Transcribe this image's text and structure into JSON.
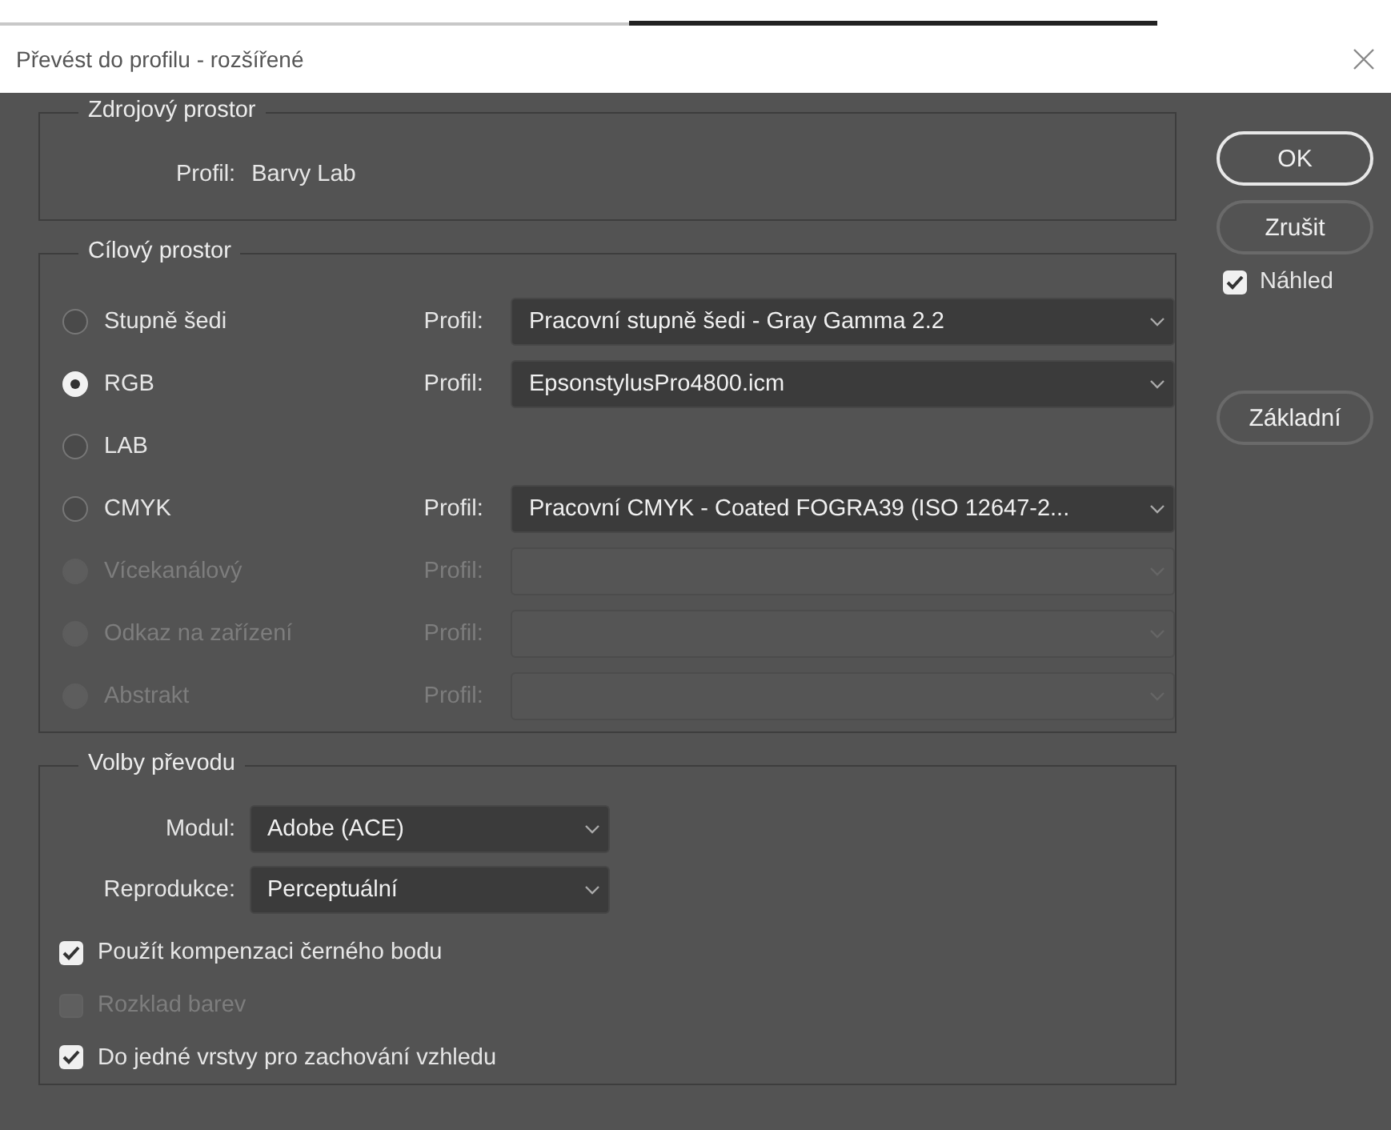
{
  "window": {
    "title": "Převést do profilu - rozšířené"
  },
  "source_space": {
    "title": "Zdrojový prostor",
    "profile_label": "Profil:",
    "profile_value": "Barvy Lab"
  },
  "target_space": {
    "title": "Cílový prostor",
    "rows": [
      {
        "label": "Stupně šedi",
        "selected": false,
        "disabled": false,
        "profile_label": "Profil:",
        "profile_value": "Pracovní stupně šedi - Gray Gamma 2.2"
      },
      {
        "label": "RGB",
        "selected": true,
        "disabled": false,
        "profile_label": "Profil:",
        "profile_value": "EpsonstylusPro4800.icm"
      },
      {
        "label": "LAB",
        "selected": false,
        "disabled": false
      },
      {
        "label": "CMYK",
        "selected": false,
        "disabled": false,
        "profile_label": "Profil:",
        "profile_value": "Pracovní CMYK - Coated FOGRA39 (ISO 12647-2..."
      },
      {
        "label": "Vícekanálový",
        "selected": false,
        "disabled": true,
        "profile_label": "Profil:",
        "profile_value": ""
      },
      {
        "label": "Odkaz na zařízení",
        "selected": false,
        "disabled": true,
        "profile_label": "Profil:",
        "profile_value": ""
      },
      {
        "label": "Abstrakt",
        "selected": false,
        "disabled": true,
        "profile_label": "Profil:",
        "profile_value": ""
      }
    ]
  },
  "conversion_options": {
    "title": "Volby převodu",
    "fields": [
      {
        "label": "Modul:",
        "value": "Adobe (ACE)"
      },
      {
        "label": "Reprodukce:",
        "value": "Perceptuální"
      }
    ],
    "checkboxes": [
      {
        "label": "Použít kompenzaci černého bodu",
        "checked": true,
        "disabled": false
      },
      {
        "label": "Rozklad barev",
        "checked": false,
        "disabled": true
      },
      {
        "label": "Do jedné vrstvy pro zachování vzhledu",
        "checked": true,
        "disabled": false
      }
    ]
  },
  "buttons": [
    {
      "label": "OK",
      "kind": "default"
    },
    {
      "label": "Zrušit",
      "kind": "normal"
    }
  ],
  "preview": {
    "label": "Náhled",
    "checked": true
  },
  "basic_button": {
    "label": "Základní"
  }
}
